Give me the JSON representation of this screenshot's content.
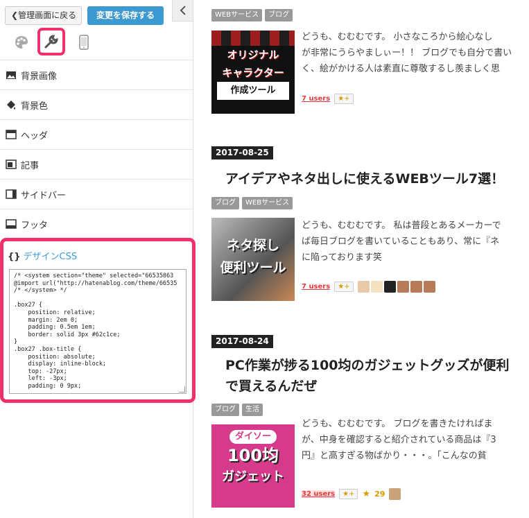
{
  "left_panel": {
    "back_label": "管理画面に戻る",
    "save_label": "変更を保存する",
    "sections": [
      "背景画像",
      "背景色",
      "ヘッダ",
      "記事",
      "サイドバー",
      "フッタ"
    ],
    "css_title": "デザインCSS",
    "css_brace": "{}",
    "css_code": "/* <system section=\"theme\" selected=\"66535863\n@import url(\"http://hatenablog.com/theme/66535\n/* </system> */\n\n.box27 {\n    position: relative;\n    margin: 2em 0;\n    padding: 0.5em 1em;\n    border: solid 3px #62c1ce;\n}\n.box27 .box-title {\n    position: absolute;\n    display: inline-block;\n    top: -27px;\n    left: -3px;\n    padding: 0 9px;"
  },
  "posts": [
    {
      "tags": [
        "WEBサービス",
        "ブログ"
      ],
      "thumb_lines": [
        "オリジナル",
        "キャラクター",
        "作成ツール"
      ],
      "excerpt": [
        "どうも、むむむです。 小さなころから絵心なし",
        "が非常にうらやましぃー！！ ブログでも自分で書い",
        "く、絵がかける人は素直に尊敬するし羨ましく思"
      ],
      "users": "7 users",
      "star_label": "★+"
    },
    {
      "date": "2017-08-25",
      "title": "アイデアやネタ出しに使えるWEBツール7選！",
      "tags": [
        "ブログ",
        "WEBサービス"
      ],
      "thumb_lines": [
        "ネタ探し",
        "便利ツール"
      ],
      "excerpt": [
        "どうも、むむむです。 私は普段とあるメーカーで",
        "ば毎日ブログを書いていることもあり、常に『ネ",
        "に陥っております笑"
      ],
      "users": "7 users",
      "star_label": "★+"
    },
    {
      "date": "2017-08-24",
      "title_lines": [
        "PC作業が捗る100均のガジェットグッズが便利",
        "で買えるんだぜ"
      ],
      "tags": [
        "ブログ",
        "生活"
      ],
      "thumb_lines": [
        "ダイソー",
        "100均",
        "ガジェット"
      ],
      "excerpt": [
        "どうも、むむむです。 ブログを書きたければま",
        "が、中身を確認すると紹介されている商品は『3",
        "円』と高すぎる物ばかり・・・。「こんなの貧"
      ],
      "users": "32 users",
      "star_label": "★+",
      "star_count": "29"
    }
  ],
  "colors": {
    "accent": "#f0306a",
    "save": "#3d9ad1",
    "users": "#e53a40"
  }
}
